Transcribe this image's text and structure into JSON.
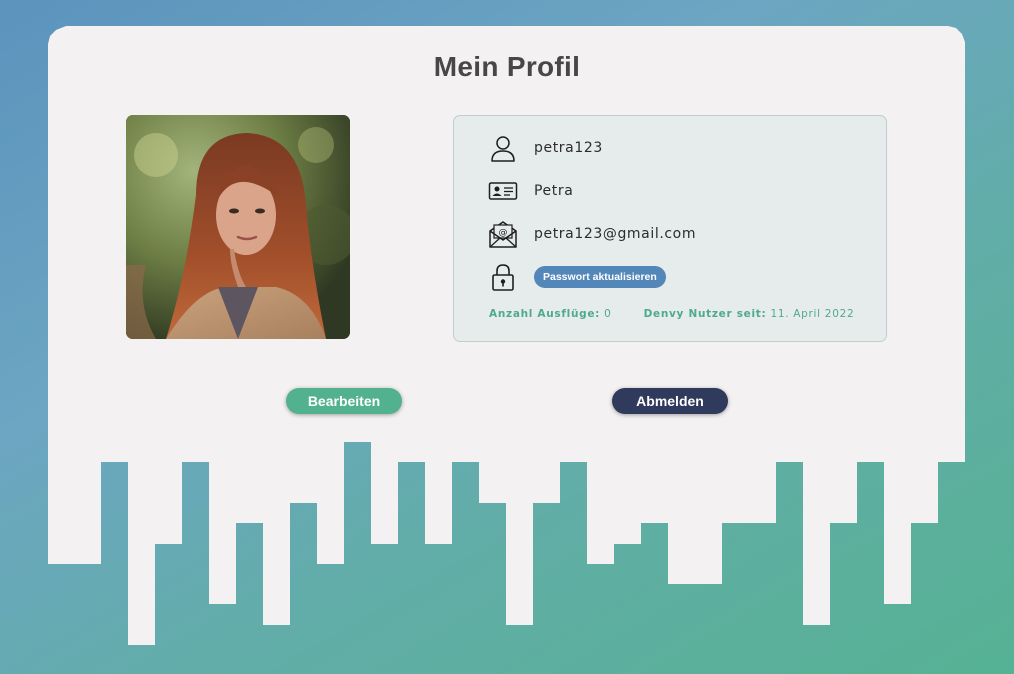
{
  "page": {
    "title": "Mein Profil"
  },
  "profile": {
    "photo_alt": "",
    "username": "petra123",
    "name": "Petra",
    "email": "petra123@gmail.com",
    "password_button": "Passwort aktualisieren"
  },
  "stats": {
    "trips_label": "Anzahl Ausflüge:",
    "trips_value": "0",
    "member_label": "Denvy Nutzer seit:",
    "member_value": "11. April 2022"
  },
  "actions": {
    "edit_label": "Bearbeiten",
    "logout_label": "Abmelden"
  },
  "icons": {
    "username": "user-icon",
    "name": "id-card-icon",
    "email": "email-icon",
    "password": "lock-icon"
  },
  "colors": {
    "accent_green": "#52b28f",
    "accent_blue": "#5386b9",
    "dark_navy": "#2f3a5c",
    "card_bg": "#f3f1f2",
    "info_bg": "#e6eceb"
  }
}
